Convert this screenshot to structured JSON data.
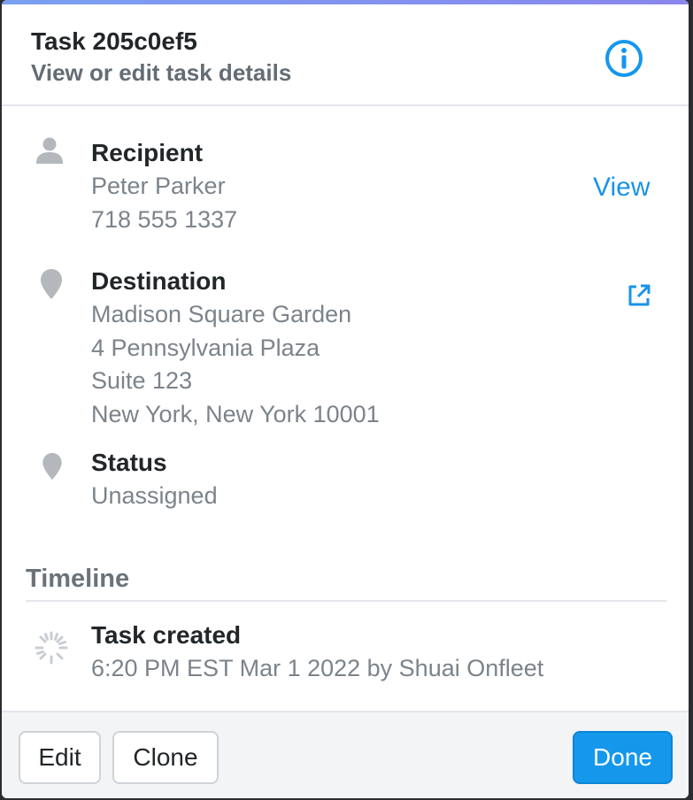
{
  "header": {
    "title": "Task 205c0ef5",
    "subtitle": "View or edit task details",
    "info_icon": "info-circle-icon"
  },
  "recipient": {
    "label": "Recipient",
    "name": "Peter Parker",
    "phone": "718 555 1337",
    "view_link": "View",
    "icon": "person-icon"
  },
  "destination": {
    "label": "Destination",
    "lines": [
      "Madison Square Garden",
      "4 Pennsylvania Plaza",
      "Suite 123",
      "New York, New York 10001"
    ],
    "icon": "map-pin-icon",
    "external_icon": "external-link-icon"
  },
  "status": {
    "label": "Status",
    "value": "Unassigned",
    "icon": "map-pin-icon"
  },
  "timeline": {
    "title": "Timeline",
    "events": [
      {
        "title": "Task created",
        "detail": "6:20 PM EST Mar 1 2022 by Shuai Onfleet",
        "icon": "spinner-icon"
      }
    ]
  },
  "footer": {
    "edit_label": "Edit",
    "clone_label": "Clone",
    "done_label": "Done"
  },
  "colors": {
    "accent": "#1597ec",
    "link": "#1a93e8",
    "text": "#222629",
    "muted": "#7c838a"
  }
}
